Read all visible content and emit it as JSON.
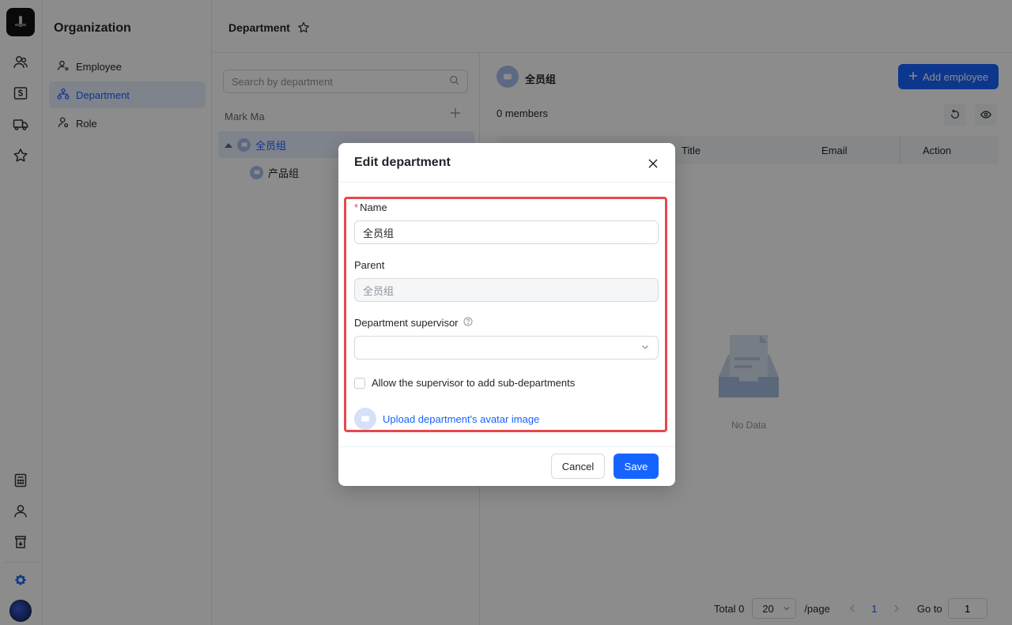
{
  "colors": {
    "accent": "#1664ff",
    "highlight": "#e5484d",
    "overlay": "rgba(0,0,0,0.45)"
  },
  "rail": {
    "icons": [
      "users-icon",
      "billing-icon",
      "truck-icon",
      "star-icon",
      "calculator-icon",
      "user-icon",
      "export-icon",
      "settings-icon"
    ]
  },
  "sidebar": {
    "title": "Organization",
    "items": [
      {
        "label": "Employee",
        "icon": "employee-icon"
      },
      {
        "label": "Department",
        "icon": "department-icon",
        "active": true
      },
      {
        "label": "Role",
        "icon": "role-icon"
      }
    ]
  },
  "header": {
    "title": "Department"
  },
  "tree": {
    "search_placeholder": "Search by department",
    "root_label": "Mark Ma",
    "nodes": [
      {
        "label": "全员组",
        "selected": true,
        "expanded": true
      },
      {
        "label": "产品组",
        "selected": false
      }
    ]
  },
  "content": {
    "title": "全员组",
    "add_button": "Add employee",
    "members": "0 members",
    "columns": [
      "Title",
      "Email",
      "Action"
    ],
    "empty_text": "No Data"
  },
  "pagination": {
    "total": "Total 0",
    "page_size": "20",
    "per_page": "/page",
    "current_page": "1",
    "goto_label": "Go to",
    "goto_value": "1"
  },
  "modal": {
    "title": "Edit department",
    "name_label": "Name",
    "name_required": "*",
    "name_value": "全员组",
    "parent_label": "Parent",
    "parent_value": "全员组",
    "supervisor_label": "Department supervisor",
    "supervisor_value": "",
    "checkbox_label": "Allow the supervisor to add sub-departments",
    "upload_label": "Upload department's avatar image",
    "cancel": "Cancel",
    "save": "Save"
  }
}
